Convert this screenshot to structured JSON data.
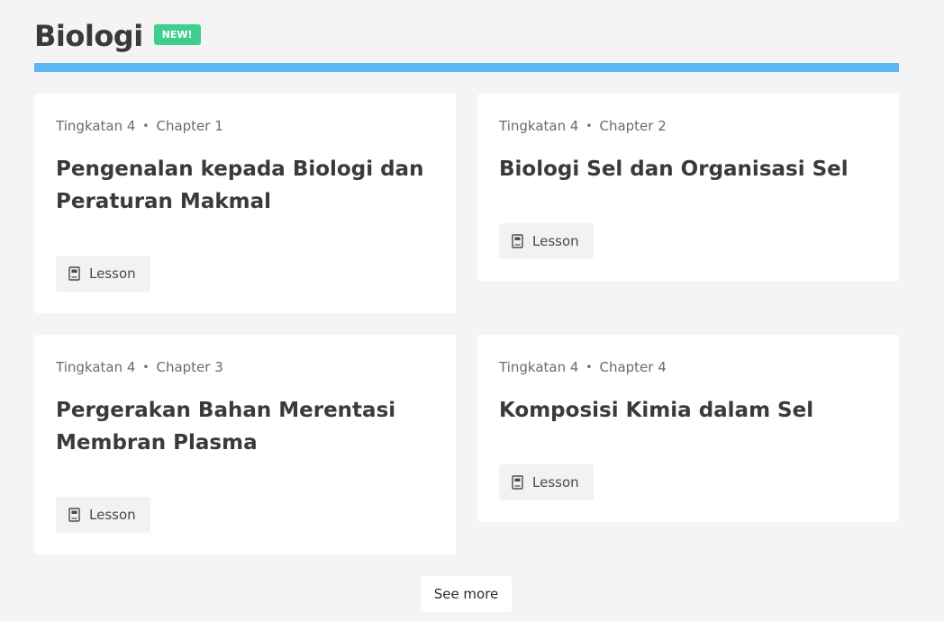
{
  "section": {
    "title": "Biologi",
    "badge": "NEW!"
  },
  "colors": {
    "accent_bar": "#5bb8f5",
    "badge": "#3ecf8e",
    "background": "#f4f4f4"
  },
  "cards": [
    {
      "level": "Tingkatan 4",
      "separator": "•",
      "chapter": "Chapter 1",
      "title": "Pengenalan kepada Biologi dan Peraturan Makmal",
      "button_label": "Lesson",
      "button_icon": "lesson-book-icon"
    },
    {
      "level": "Tingkatan 4",
      "separator": "•",
      "chapter": "Chapter 2",
      "title": "Biologi Sel dan Organisasi Sel",
      "button_label": "Lesson",
      "button_icon": "lesson-book-icon"
    },
    {
      "level": "Tingkatan 4",
      "separator": "•",
      "chapter": "Chapter 3",
      "title": "Pergerakan Bahan Merentasi Membran Plasma",
      "button_label": "Lesson",
      "button_icon": "lesson-book-icon"
    },
    {
      "level": "Tingkatan 4",
      "separator": "•",
      "chapter": "Chapter 4",
      "title": "Komposisi Kimia dalam Sel",
      "button_label": "Lesson",
      "button_icon": "lesson-book-icon"
    }
  ],
  "see_more_label": "See more"
}
